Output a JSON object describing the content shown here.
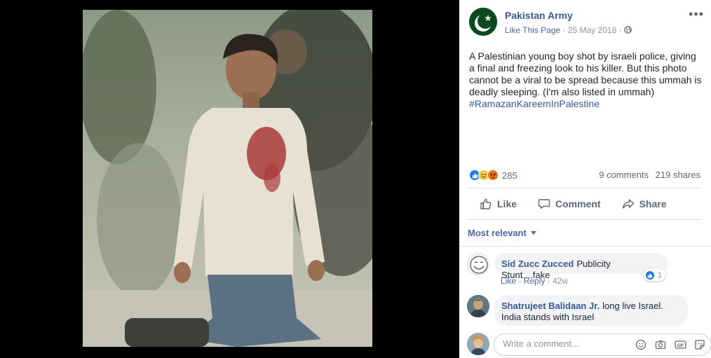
{
  "post": {
    "page_name": "Pakistan Army",
    "like_page": "Like This Page",
    "date": "25 May 2018",
    "text": "A Palestinian young boy shot by israeli police, giving a final and freezing look to his killer. But this photo cannot be a viral to be spread because this ummah is deadly sleeping. (I'm also listed in ummah)",
    "hashtag": "#RamazanKareemInPalestine"
  },
  "stats": {
    "reaction_count": "285",
    "comments": "9 comments",
    "shares": "219 shares",
    "reaction_icons": [
      "like-reaction-icon",
      "sad-reaction-icon",
      "angry-reaction-icon"
    ]
  },
  "actions": {
    "like": "Like",
    "comment": "Comment",
    "share": "Share"
  },
  "comments": {
    "sort_label": "Most relevant",
    "items": [
      {
        "author": "Sid Zucc Zucced",
        "text": "Publicity Stunt....fake",
        "like_label": "Like",
        "reply_label": "Reply",
        "time": "42w",
        "likes": "1"
      },
      {
        "author": "Shatrujeet Balidaan Jr.",
        "text_line1": "long live Israel.",
        "text_line2": "India stands with Israel"
      }
    ]
  },
  "composer": {
    "placeholder": "Write a comment..."
  },
  "colors": {
    "link": "#365899",
    "meta": "#90949c",
    "background_viewer": "#000000",
    "panel": "#ffffff"
  }
}
